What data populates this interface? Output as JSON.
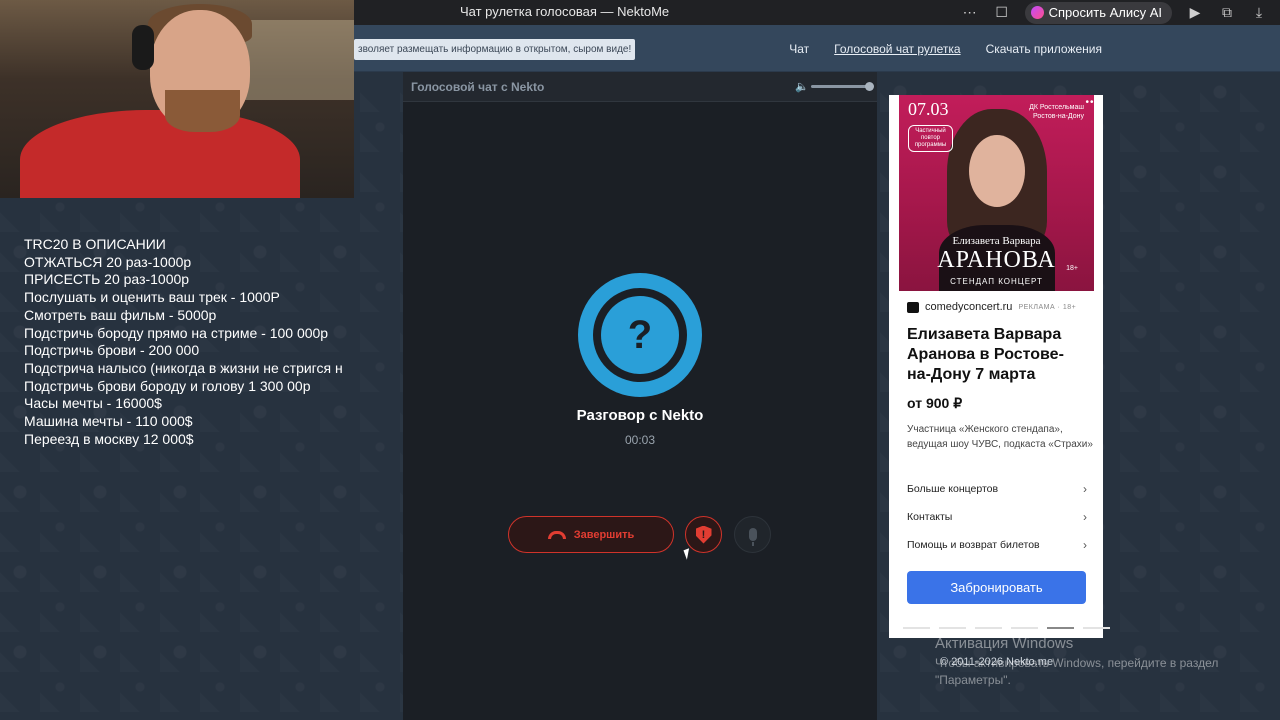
{
  "browser": {
    "title": "Чат рулетка голосовая — NektoMe",
    "alice_label": "Спросить Алису AI",
    "icons": [
      "more-icon",
      "bookmark-icon",
      "alice-icon",
      "play-icon",
      "screenshot-icon",
      "download-icon"
    ]
  },
  "site": {
    "notice": "зволяет размещать информацию в открытом, сыром виде!",
    "nav": [
      "Чат",
      "Голосовой чат рулетка",
      "Скачать приложения"
    ]
  },
  "overlay": {
    "lines": [
      "TRC20 В ОПИСАНИИ",
      "ОТЖАТЬСЯ 20 раз-1000р",
      "ПРИСЕСТЬ 20 раз-1000р",
      "Послушать и оценить ваш трек - 1000Р",
      "Смотреть ваш фильм - 5000р",
      "Подстричь бороду прямо на стриме - 100 000р",
      "Подстричь брови - 200 000",
      "Подстрича налысо (никогда в жизни не стригся н",
      "Подстричь брови бороду и голову 1 300 00р",
      "Часы мечты - 16000$",
      "Машина мечты - 110 000$",
      "Переезд в москву 12 000$"
    ]
  },
  "call": {
    "header_title": "Голосовой чат с Nekto",
    "volume_level": 1.0,
    "avatar_glyph": "?",
    "partner_name": "Разговор с Nekto",
    "timer": "00:03",
    "end_label": "Завершить",
    "report_glyph": "!",
    "colors": {
      "accent": "#2a9fd8",
      "danger": "#e23d32"
    }
  },
  "ad": {
    "more": "•••",
    "poster": {
      "date": "07.03",
      "venue": "ДК Ростсельмаш Ростов-на-Дону",
      "badge": "Частичный повтор программы",
      "name1": "Елизавета Варвара",
      "name2": "АРАНОВА",
      "age": "18+",
      "subtitle": "СТЕНДАП КОНЦЕРТ"
    },
    "source": "comedyconcert.ru",
    "tag": "РЕКЛАМА · 18+",
    "title": "Елизавета Варвара Аранова в Ростове-на-Дону 7 марта",
    "price": "от 900 ₽",
    "description": "Участница «Женского стендапа», ведущая шоу ЧУВС, подкаста «Страхи»",
    "links": [
      "Больше концертов",
      "Контакты",
      "Помощь и возврат билетов"
    ],
    "cta": "Забронировать"
  },
  "footer": {
    "copyright": "© 2011-2026 Nekto.me"
  },
  "watermark": {
    "title": "Активация Windows",
    "subtitle": "Чтобы активировать Windows, перейдите в раздел \"Параметры\"."
  }
}
